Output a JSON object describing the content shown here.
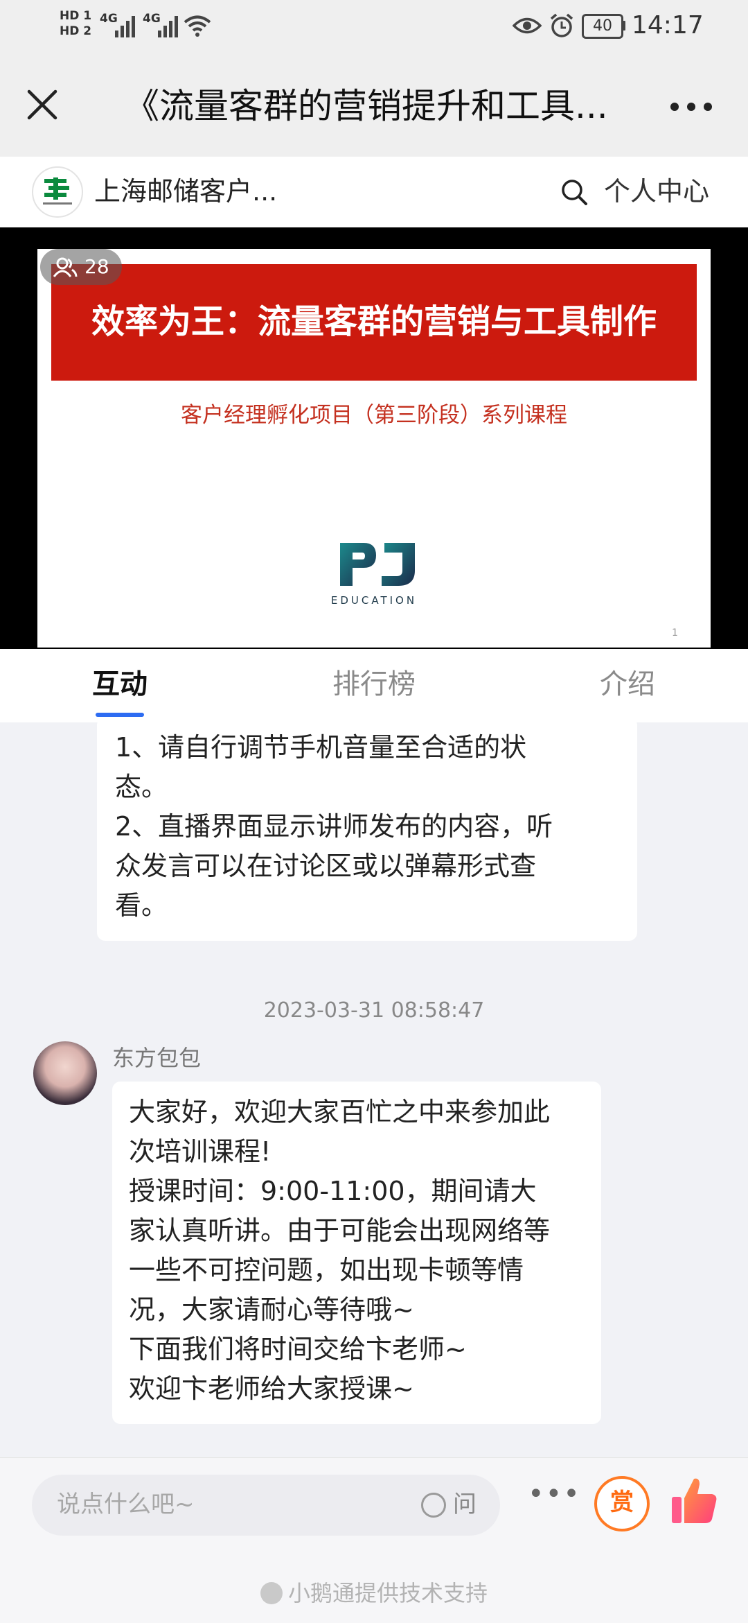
{
  "status_bar": {
    "sim1": "HD 1",
    "sim2": "HD 2",
    "net1": "4G",
    "net2": "4G",
    "battery": "40",
    "time": "14:17"
  },
  "title_bar": {
    "title": "《流量客群的营销提升和工具..."
  },
  "sub_header": {
    "org_name": "上海邮储客户...",
    "personal_center": "个人中心"
  },
  "video": {
    "viewer_count": "28",
    "slide_title": "效率为王：流量客群的营销与工具制作",
    "slide_subtitle": "客户经理孵化项目（第三阶段）系列课程",
    "logo_caption": "EDUCATION",
    "page_number": "1"
  },
  "tabs": [
    {
      "label": "互动",
      "active": true
    },
    {
      "label": "排行榜",
      "active": false
    },
    {
      "label": "介绍",
      "active": false
    }
  ],
  "chat": {
    "notice_lines": [
      "1、请自行调节手机音量至合适的状",
      "态。",
      "2、直播界面显示讲师发布的内容，听",
      "众发言可以在讨论区或以弹幕形式查",
      "看。"
    ],
    "timestamp": "2023-03-31 08:58:47",
    "author": "东方包包",
    "message_lines": [
      "大家好，欢迎大家百忙之中来参加此",
      "次培训课程!",
      "授课时间：9:00-11:00，期间请大",
      "家认真听讲。由于可能会出现网络等",
      "一些不可控问题，如出现卡顿等情",
      "况，大家请耐心等待哦~",
      "下面我们将时间交给卞老师~",
      "欢迎卞老师给大家授课~"
    ]
  },
  "bottom_bar": {
    "input_placeholder": "说点什么吧~",
    "ask_label": "问",
    "more": "•••",
    "reward_label": "赏",
    "powered_by": "小鹅通提供技术支持"
  },
  "colors": {
    "accent_blue": "#2d6cf2",
    "slide_red": "#cc1a0e",
    "reward_orange": "#ff7a24"
  }
}
